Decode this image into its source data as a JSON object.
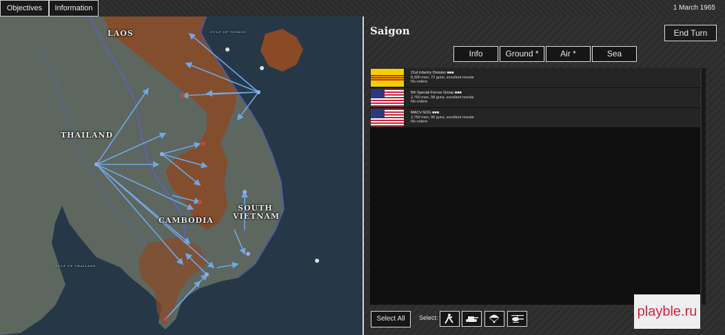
{
  "topbar": {
    "objectives_label": "Objectives",
    "information_label": "Information",
    "date": "1 March 1965"
  },
  "map": {
    "regions": [
      "LAOS",
      "THAILAND",
      "CAMBODIA",
      "SOUTH",
      "VIETNAM"
    ],
    "water_labels": [
      "GULF OF TONKIN",
      "GULF OF THAILAND"
    ],
    "colors": {
      "sea": "#263848",
      "land": "#5e6660",
      "highland": "#8a4a26",
      "arrow": "#6fa8e6",
      "border": "#5b63c8"
    }
  },
  "panel": {
    "city": "Saigon",
    "end_turn_label": "End Turn",
    "tabs": [
      "Info",
      "Ground *",
      "Air *",
      "Sea"
    ],
    "units": [
      {
        "flag": "south-vietnam-flag",
        "name": "21st Infantry Division ■■■",
        "strength": "8,300 men, 72 guns, excellent morale",
        "orders": "No orders"
      },
      {
        "flag": "usa-flag",
        "name": "5th Special Forces Group ■■■",
        "strength": "2,750 men, 98 guns, excellent morale",
        "orders": "No orders"
      },
      {
        "flag": "usa-flag",
        "name": "MACV-SOG ■■■",
        "strength": "2,750 men, 98 guns, excellent morale",
        "orders": "No orders"
      }
    ],
    "select_all_label": "Select All",
    "select_label": "Select:",
    "filter_icons": [
      "infantry-icon",
      "tank-icon",
      "paratrooper-icon",
      "helicopter-icon"
    ]
  },
  "watermark": "playble.ru"
}
